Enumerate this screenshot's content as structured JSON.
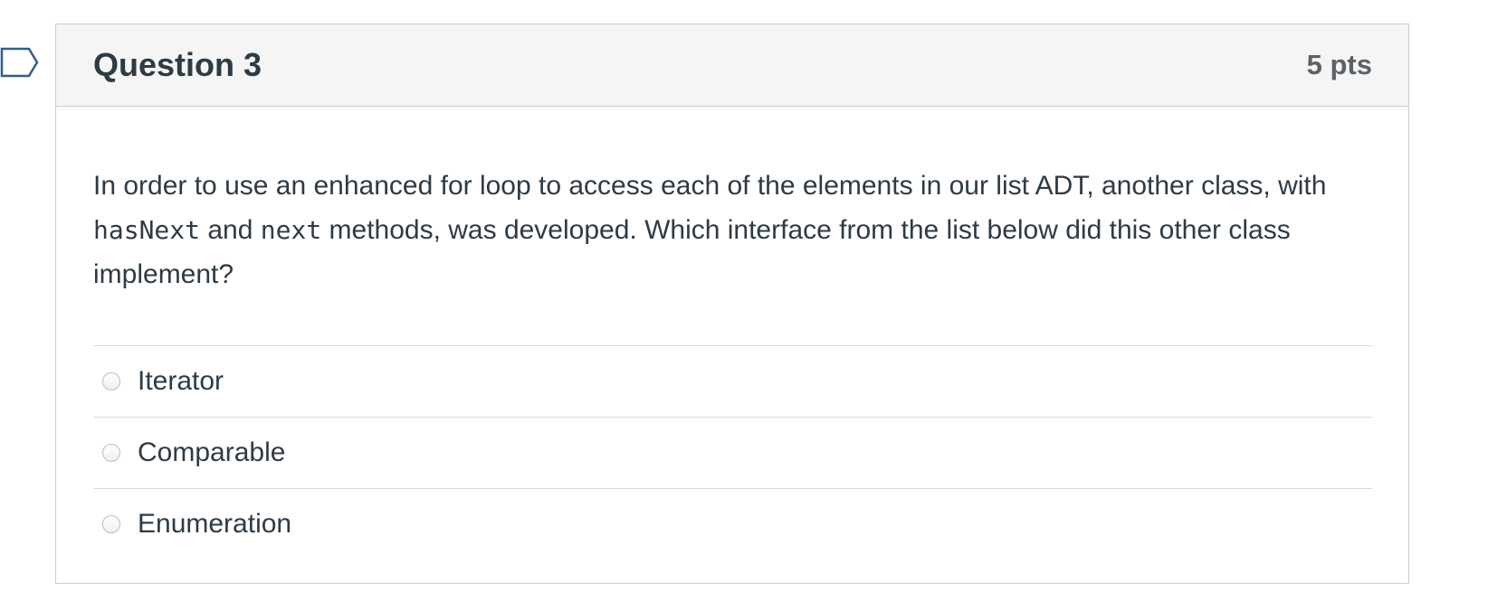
{
  "question": {
    "title": "Question 3",
    "points": "5 pts",
    "text_part1": "In order to use an enhanced for loop to access each of the elements in our list ADT, another class, with ",
    "code1": "hasNext",
    "text_part2": " and ",
    "code2": "next",
    "text_part3": " methods, was developed. Which interface from the list below did this other class implement?"
  },
  "answers": [
    {
      "label": "Iterator",
      "selected": false
    },
    {
      "label": "Comparable",
      "selected": false
    },
    {
      "label": "Enumeration",
      "selected": false
    }
  ],
  "icons": {
    "flag": "flag-icon"
  },
  "colors": {
    "text": "#2d3b45",
    "header_bg": "#f5f5f5",
    "border": "#c7cdd1",
    "flag_outline": "#2d3b45"
  }
}
